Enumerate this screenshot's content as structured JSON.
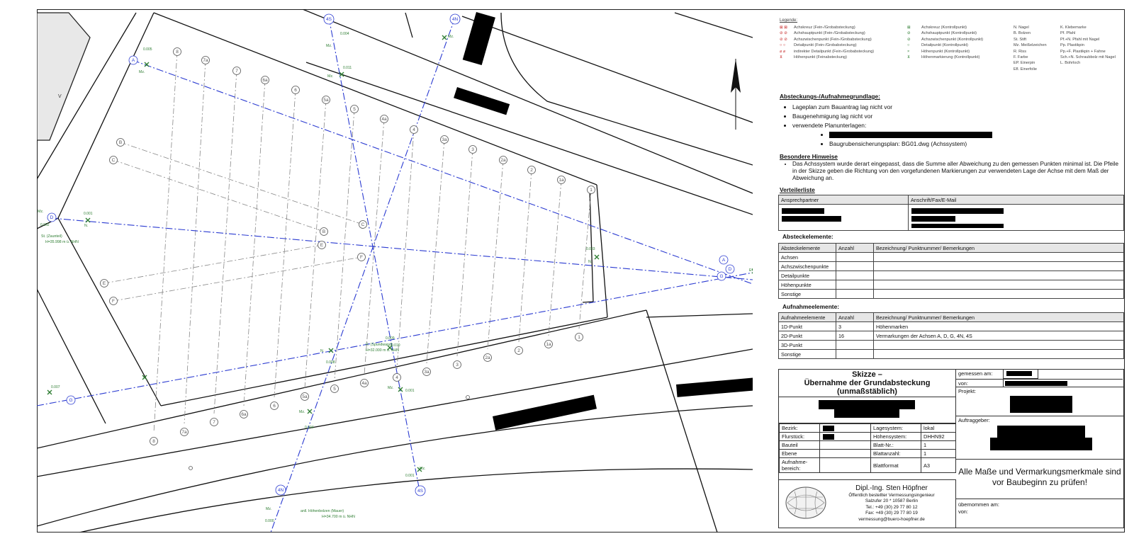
{
  "legend": {
    "title": "Legende:",
    "col1": [
      "Achskreuz (Fein-/Grobabsteckung)",
      "Achshauptpunkt (Fein-/Grobabsteckung)",
      "Achszwischenpunkt (Fein-/Grobabsteckung)",
      "Detailpunkt (Fein-/Grobabsteckung)",
      "indirekter Detailpunkt (Fein-/Grobabsteckung)",
      "Höhenpunkt (Feinabsteckung)"
    ],
    "col2": [
      "Achskreuz (Kontrollpunkt)",
      "Achshauptpunkt (Kontrollpunkt)",
      "Achszwischenpunkt (Kontrollpunkt)",
      "Detailpunkt (Kontrollpunkt)",
      "Höhenpunkt (Kontrollpunkt)",
      "Höhenmarkierung (Kontrollpunkt)"
    ],
    "abbr1": [
      "N.  Nagel",
      "B.  Bolzen",
      "St.  Stift",
      "Mz.  Meißelzeichen",
      "R.  Riss",
      "F.  Farbe",
      "EP.  Einerpin",
      "Efl.  Einerfolie"
    ],
    "abbr2": [
      "K.  Klebemarke",
      "Pf.  Pfahl",
      "Pf.+N.  Pfahl mit Nagel",
      "Pp.  Plastikpin",
      "Pp.+F.  Plastikpin + Fahne",
      "Sch.+N.  Schraubbolz mit Nagel",
      "L.  Bohrloch"
    ]
  },
  "grundlage": {
    "title": "Absteckungs-/Aufnahmegrundlage:",
    "items": [
      "Lageplan zum Bauantrag lag nicht vor",
      "Baugenehmigung lag nicht vor",
      "verwendete Planunterlagen:"
    ],
    "subitem": "Baugrubensicherungsplan: BG01.dwg (Achssystem)"
  },
  "hinweise": {
    "title": "Besondere Hinweise",
    "text": "Das Achssystem wurde derart eingepasst, dass die Summe aller Abweichung zu den gemessen Punkten minimal ist. Die Pfeile in der Skizze geben die Richtung von den vorgefundenen Markierungen zur verwendeten Lage der Achse mit dem Maß der Abweichung an."
  },
  "verteiler": {
    "title": "Verteilerliste",
    "headers": [
      "Ansprechpartner",
      "Anschrift/Fax/E-Mail"
    ]
  },
  "absteck": {
    "title": "Absteckelemente:",
    "headers": [
      "Absteckelemente",
      "Anzahl",
      "Bezeichnung/ Punktnummer/ Bemerkungen"
    ],
    "rows": [
      [
        "Achsen",
        "",
        ""
      ],
      [
        "Achszwischenpunkte",
        "",
        ""
      ],
      [
        "Detailpunkte",
        "",
        ""
      ],
      [
        "Höhenpunkte",
        "",
        ""
      ],
      [
        "Sonstige",
        "",
        ""
      ]
    ]
  },
  "aufnahme": {
    "title": "Aufnahmeelemente:",
    "headers": [
      "Aufnahmeelemente",
      "Anzahl",
      "Bezeichnung/ Punktnummer/ Bemerkungen"
    ],
    "rows": [
      [
        "1D-Punkt",
        "3",
        "Höhenmarken"
      ],
      [
        "2D-Punkt",
        "16",
        "Vermarkungen der Achsen A, D, G, 4N, 4S"
      ],
      [
        "3D-Punkt",
        "",
        ""
      ],
      [
        "Sonstige",
        "",
        ""
      ]
    ]
  },
  "skizze": {
    "title1": "Skizze –",
    "title2": "Übernahme der Grundabsteckung",
    "title3": "(unmaßstäblich)",
    "gemessen": "gemessen am:",
    "von": "von:",
    "projekt": "Projekt:",
    "auftraggeber": "Auftraggeber:",
    "fields": [
      [
        "Bezirk:",
        "",
        "Lagesystem:",
        "lokal"
      ],
      [
        "Flurstück:",
        "",
        "Höhensystem:",
        "DHHN92"
      ],
      [
        "Bauteil",
        "",
        "Blatt-Nr.:",
        "1"
      ],
      [
        "Ebene",
        "",
        "Blattanzahl:",
        "1"
      ],
      [
        "Aufnahme-bereich:",
        "",
        "Blattformat",
        "A3"
      ]
    ],
    "office_name": "Dipl.-Ing. Sten Höpfner",
    "office_lines": [
      "Öffentlich bestellter Vermessungsingenieur",
      "Salzufer 20 * 10587 Berlin",
      "Tel.: +49 (30) 29 77 80 12",
      "Fax: +49 (30) 29 77 80 19",
      "vermessung@buero-hoepfner.de"
    ],
    "warning": "Alle Maße und Vermarkungsmerkmale sind vor Baubeginn zu prüfen!",
    "uebernommen": "übernommen am:",
    "uebernommen_von": "von:"
  },
  "map": {
    "axis_labels": [
      "A",
      "D",
      "G",
      "4N",
      "4S",
      "A",
      "D",
      "G"
    ],
    "grid_labels_top": [
      "8",
      "7a",
      "7",
      "6a",
      "6",
      "5a",
      "5",
      "4a",
      "4",
      "3a",
      "3",
      "2a",
      "2",
      "1a",
      "1"
    ],
    "grid_labels_bottom": [
      "8",
      "7a",
      "7",
      "6a",
      "6",
      "5a",
      "5",
      "4a",
      "4",
      "3a",
      "3",
      "2a",
      "2",
      "1a",
      "1"
    ],
    "grid_labels_left": [
      "B",
      "C",
      "E",
      "F"
    ],
    "grid_labels_mid": [
      "C",
      "B",
      "E",
      "F"
    ],
    "annotations": {
      "st_zaun": "St. (Zaunteil)",
      "st_zaun_h": "H=35.998 m ü. NHN",
      "r_sp": "R. (Spundwand)",
      "r_sp_h": "H=32.000 m ü. NHN",
      "hb": "anll. Höhenbolzen (Mauer)",
      "hb_h": "H=34.700 m ü. NHN",
      "mz": "Mz.",
      "n": "N.",
      "efl": "Efl.",
      "v": "V"
    },
    "deviations": [
      "0.004",
      "0.011",
      "0.005",
      "0.001",
      "0.002",
      "0.003",
      "0.008",
      "0.010",
      "0.009",
      "0.004",
      "0.007",
      "0.001",
      "0.000",
      "0.001"
    ]
  }
}
